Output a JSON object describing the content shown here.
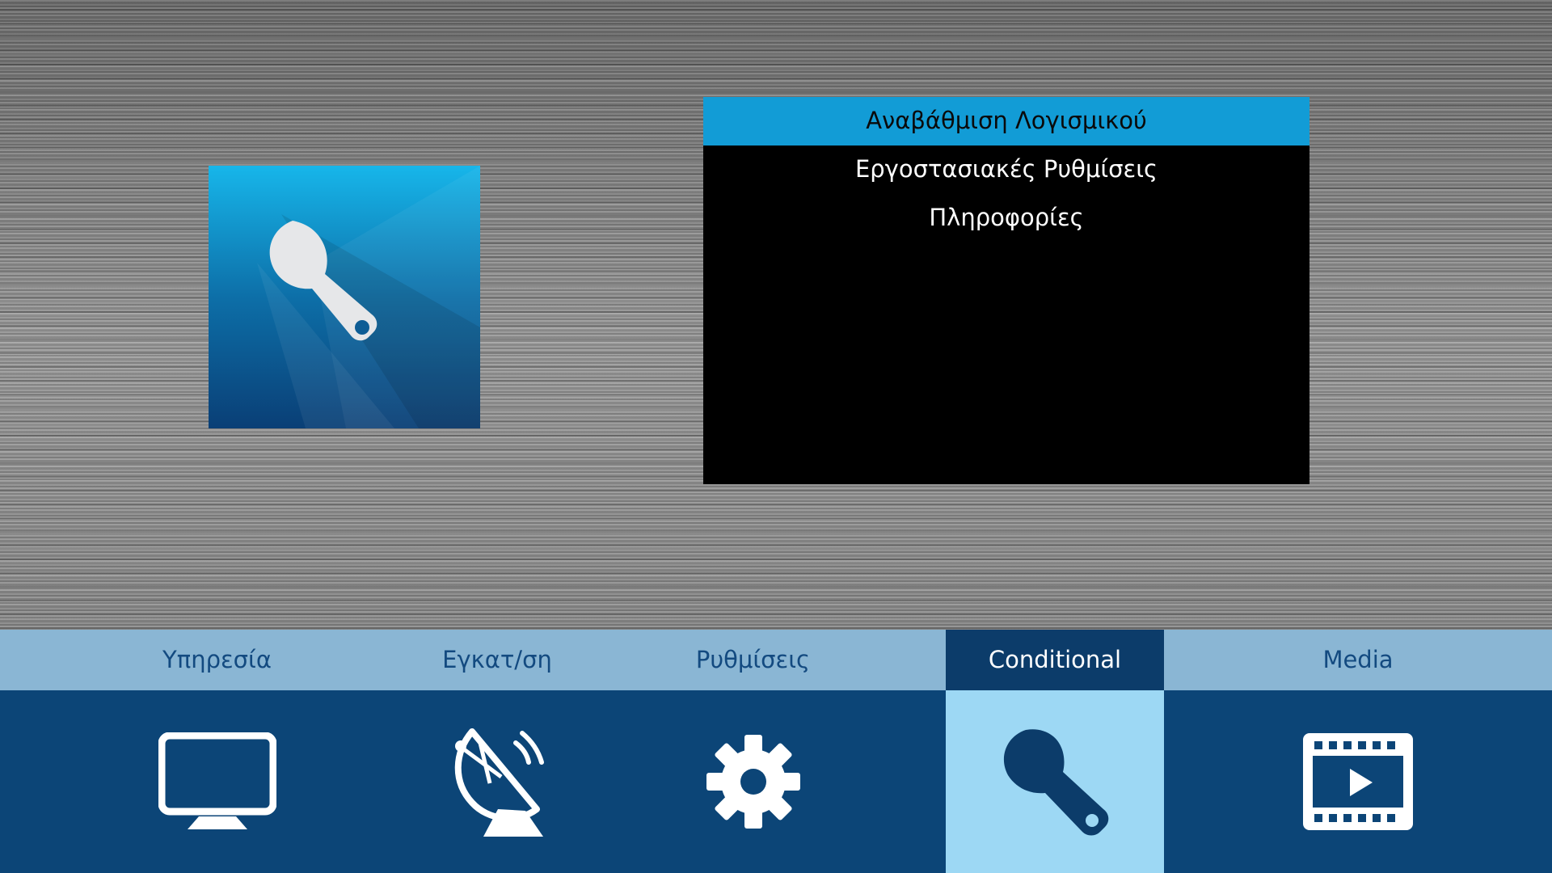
{
  "feature_tile": {
    "icon": "wrench-icon"
  },
  "menu": {
    "items": [
      {
        "label": "Αναβάθμιση Λογισμικού",
        "selected": true
      },
      {
        "label": "Εργοστασιακές Ρυθμίσεις",
        "selected": false
      },
      {
        "label": "Πληροφορίες",
        "selected": false
      }
    ],
    "colors": {
      "selected_bg": "#129cd6",
      "panel_bg": "#000000"
    }
  },
  "nav": {
    "tabs": [
      {
        "label": "Υπηρεσία",
        "icon": "tv-icon",
        "active": false
      },
      {
        "label": "Εγκατ/ση",
        "icon": "satellite-dish-icon",
        "active": false
      },
      {
        "label": "Ρυθμίσεις",
        "icon": "gear-icon",
        "active": false
      },
      {
        "label": "Conditional",
        "icon": "wrench-icon",
        "active": true
      },
      {
        "label": "Media",
        "icon": "media-player-icon",
        "active": false
      }
    ],
    "colors": {
      "label_bar": "#8ab6d4",
      "icon_bar": "#0c4577",
      "active_label_bg": "#0c3c6a",
      "active_icon_bg": "#9dd8f4"
    }
  }
}
